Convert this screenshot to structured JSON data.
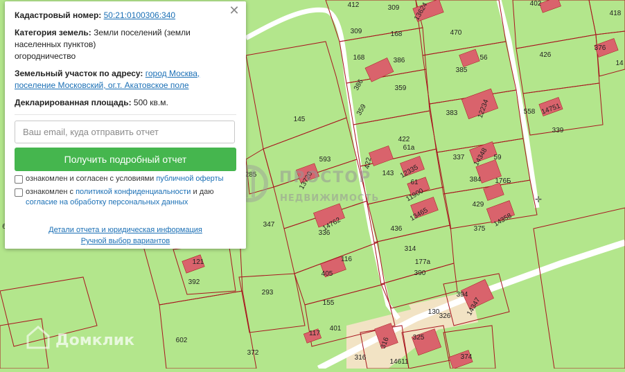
{
  "card": {
    "cadastral_label": "Кадастровый номер:",
    "cadastral_number": "50:21:0100306:340",
    "category_label": "Категория земель:",
    "category_value_line1": "Земли поселений (земли",
    "category_value_line2": "населенных пунктов)",
    "category_value_line3": "огородничество",
    "address_label": "Земельный участок по адресу:",
    "address_link_line1": "город Москва,",
    "address_link_line2": "поселение Московский, ог.т. Акатовское поле",
    "area_label": "Декларированная площадь:",
    "area_value": "500 кв.м.",
    "email_placeholder": "Ваш email, куда отправить отчет",
    "submit_label": "Получить подробный отчет",
    "consent1_prefix": "ознакомлен и согласен с условиями",
    "consent1_link": "публичной оферты",
    "consent2_prefix": "ознакомлен с",
    "consent2_link": "политикой конфиденциальности",
    "consent2_mid": "и даю",
    "consent2_link2": "согласие на обработку персональных данных",
    "details_link": "Детали отчета и юридическая информация",
    "manual_link": "Ручной выбор вариантов",
    "close_glyph": "✕"
  },
  "watermarks": {
    "prostor_line1": "ПРОСТОР",
    "prostor_line2": "НЕДВИЖИМОСТЬ",
    "domclick": "Домклик"
  },
  "map": {
    "colors": {
      "land": "#b3e68c",
      "boundary": "#a8141e",
      "building": "#d9636c",
      "road": "#ffffff",
      "beige": "#f2e3c4"
    },
    "plot_labels": [
      "412",
      "309",
      "13624",
      "470",
      "402",
      "418",
      "309",
      "168",
      "168",
      "386",
      "426",
      "376",
      "14",
      "386",
      "359",
      "385",
      "56",
      "359",
      "383",
      "12234",
      "558",
      "14751",
      "339",
      "145",
      "593",
      "13720",
      "422",
      "422",
      "61a",
      "143",
      "12335",
      "337",
      "14348",
      "59",
      "61",
      "384",
      "176Б",
      "11900",
      "285",
      "13465",
      "429",
      "14358",
      "375",
      "347",
      "14762",
      "336",
      "436",
      "314",
      "121",
      "116",
      "392",
      "405",
      "177a",
      "390",
      "394",
      "14347",
      "293",
      "155",
      "130",
      "326",
      "117",
      "401",
      "316",
      "325",
      "602",
      "372",
      "316",
      "14611",
      "374",
      "6"
    ]
  }
}
